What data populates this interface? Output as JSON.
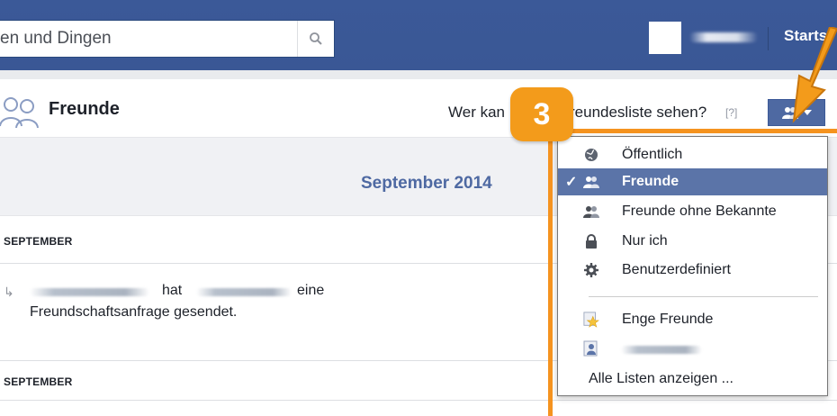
{
  "header": {
    "search_text": "en und Dingen",
    "search_icon": "magnifier-icon",
    "nav_label": "Starts"
  },
  "page": {
    "title": "Freunde",
    "privacy_prompt": "Wer kan",
    "privacy_prompt_2": "reundesliste sehen?",
    "help": "[?]"
  },
  "timeline": {
    "month": "September 2014",
    "section1": "SEPTEMBER",
    "story_hat": "hat",
    "story_eine": "eine",
    "story_line2": "Freundschaftsanfrage gesendet.",
    "section2": "SEPTEMBER"
  },
  "menu": {
    "items": [
      {
        "label": "Öffentlich",
        "icon": "globe-icon"
      },
      {
        "label": "Freunde",
        "icon": "friends-icon",
        "selected": true
      },
      {
        "label": "Freunde ohne Bekannte",
        "icon": "friends-except-icon"
      },
      {
        "label": "Nur ich",
        "icon": "lock-icon"
      },
      {
        "label": "Benutzerdefiniert",
        "icon": "gear-icon"
      }
    ],
    "lists": [
      {
        "label": "Enge Freunde",
        "icon": "star-icon"
      },
      {
        "label": "",
        "icon": "list-icon"
      },
      {
        "label": "Alle Listen anzeigen ...",
        "icon": ""
      }
    ]
  },
  "annotation": {
    "badge": "3",
    "color": "#f5931f"
  }
}
